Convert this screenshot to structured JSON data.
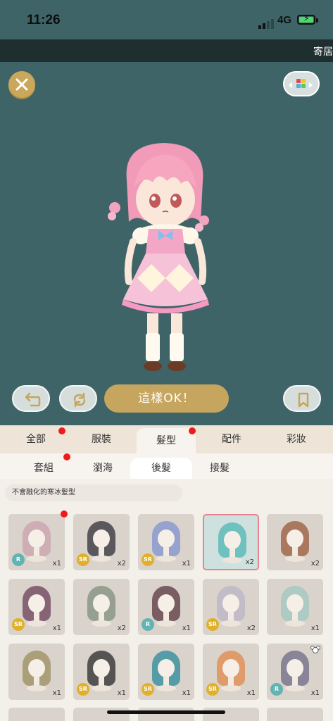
{
  "status": {
    "time": "11:26",
    "network": "4G"
  },
  "marquee": "寄居",
  "actions": {
    "ok_label": "這樣OK！"
  },
  "category_tabs": [
    {
      "label": "全部"
    },
    {
      "label": "服裝"
    },
    {
      "label": "髮型"
    },
    {
      "label": "配件"
    },
    {
      "label": "彩妝"
    }
  ],
  "sub_tabs": [
    {
      "label": "套組"
    },
    {
      "label": "瀏海"
    },
    {
      "label": "後髮"
    },
    {
      "label": "接髮"
    }
  ],
  "filter_label": "不會融化的寒冰髮型",
  "items": [
    {
      "rarity": "R",
      "count": "x1",
      "hair": "#c9a0ad"
    },
    {
      "rarity": "SR",
      "count": "x2",
      "hair": "#2f2f38"
    },
    {
      "rarity": "SR",
      "count": "x1",
      "hair": "#7f93cf"
    },
    {
      "rarity": "",
      "count": "x2",
      "hair": "#4db6b3"
    },
    {
      "rarity": "",
      "count": "x2",
      "hair": "#9a5a3a"
    },
    {
      "rarity": "SR",
      "count": "x1",
      "hair": "#6b3e5a"
    },
    {
      "rarity": "",
      "count": "x2",
      "hair": "#7d8f7d"
    },
    {
      "rarity": "R",
      "count": "x1",
      "hair": "#5a3540"
    },
    {
      "rarity": "SR",
      "count": "x2",
      "hair": "#b9b4c8"
    },
    {
      "rarity": "",
      "count": "x1",
      "hair": "#9ec8c0"
    },
    {
      "rarity": "",
      "count": "x1",
      "hair": "#9a8e5e"
    },
    {
      "rarity": "SR",
      "count": "x1",
      "hair": "#2a2a2a"
    },
    {
      "rarity": "SR",
      "count": "x1",
      "hair": "#2a8a9a"
    },
    {
      "rarity": "SR",
      "count": "x1",
      "hair": "#e08a4a"
    },
    {
      "rarity": "R",
      "count": "x1",
      "hair": "#6d6a86"
    }
  ]
}
